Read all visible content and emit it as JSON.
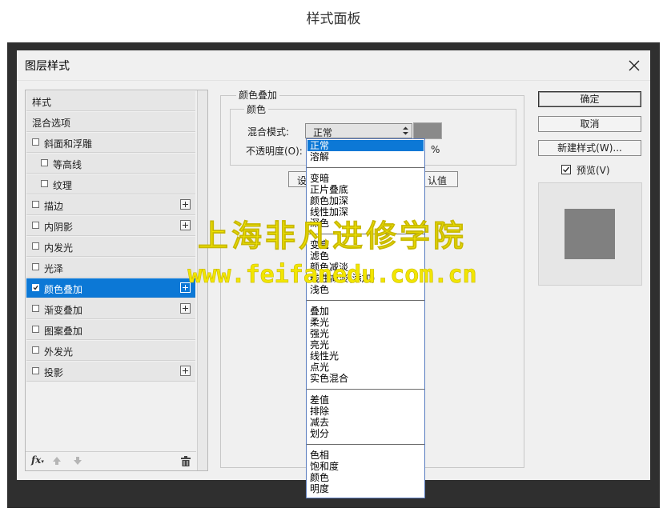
{
  "page_title": "样式面板",
  "dialog": {
    "title": "图层样式",
    "close_icon": "close-icon"
  },
  "style_list": {
    "items": [
      {
        "label": "样式",
        "checkbox": false,
        "plus": false,
        "indent": false,
        "selected": false,
        "checked": false
      },
      {
        "label": "混合选项",
        "checkbox": false,
        "plus": false,
        "indent": false,
        "selected": false,
        "checked": false
      },
      {
        "label": "斜面和浮雕",
        "checkbox": true,
        "plus": false,
        "indent": false,
        "selected": false,
        "checked": false
      },
      {
        "label": "等高线",
        "checkbox": true,
        "plus": false,
        "indent": true,
        "selected": false,
        "checked": false
      },
      {
        "label": "纹理",
        "checkbox": true,
        "plus": false,
        "indent": true,
        "selected": false,
        "checked": false
      },
      {
        "label": "描边",
        "checkbox": true,
        "plus": true,
        "indent": false,
        "selected": false,
        "checked": false
      },
      {
        "label": "内阴影",
        "checkbox": true,
        "plus": true,
        "indent": false,
        "selected": false,
        "checked": false
      },
      {
        "label": "内发光",
        "checkbox": true,
        "plus": false,
        "indent": false,
        "selected": false,
        "checked": false
      },
      {
        "label": "光泽",
        "checkbox": true,
        "plus": false,
        "indent": false,
        "selected": false,
        "checked": false
      },
      {
        "label": "颜色叠加",
        "checkbox": true,
        "plus": true,
        "indent": false,
        "selected": true,
        "checked": true
      },
      {
        "label": "渐变叠加",
        "checkbox": true,
        "plus": true,
        "indent": false,
        "selected": false,
        "checked": false
      },
      {
        "label": "图案叠加",
        "checkbox": true,
        "plus": false,
        "indent": false,
        "selected": false,
        "checked": false
      },
      {
        "label": "外发光",
        "checkbox": true,
        "plus": false,
        "indent": false,
        "selected": false,
        "checked": false
      },
      {
        "label": "投影",
        "checkbox": true,
        "plus": true,
        "indent": false,
        "selected": false,
        "checked": false
      }
    ],
    "footer": {
      "fx_label": "fx",
      "icons": [
        "fx-icon",
        "arrow-up-icon",
        "arrow-down-icon",
        "trash-icon"
      ]
    }
  },
  "color_overlay": {
    "group_title": "颜色叠加",
    "subgroup_title": "颜色",
    "blend_mode_label": "混合模式:",
    "blend_mode_value": "正常",
    "opacity_label": "不透明度(O):",
    "opacity_unit": "%",
    "swatch_color": "#8a8a8a",
    "partial_button_left": "设",
    "partial_button_right": "认值"
  },
  "blend_dropdown": {
    "selected": "正常",
    "groups": [
      [
        "正常",
        "溶解"
      ],
      [
        "变暗",
        "正片叠底",
        "颜色加深",
        "线性加深",
        "深色"
      ],
      [
        "变亮",
        "滤色",
        "颜色减淡",
        "线性减淡(添加)",
        "浅色"
      ],
      [
        "叠加",
        "柔光",
        "强光",
        "亮光",
        "线性光",
        "点光",
        "实色混合"
      ],
      [
        "差值",
        "排除",
        "减去",
        "划分"
      ],
      [
        "色相",
        "饱和度",
        "颜色",
        "明度"
      ]
    ]
  },
  "buttons": {
    "ok": "确定",
    "cancel": "取消",
    "new_style": "新建样式(W)..."
  },
  "preview": {
    "label": "预览(V)",
    "checked": true,
    "swatch_color": "#808080"
  },
  "watermark": {
    "line1": "上海非凡进修学院",
    "line2": "www.feifanedu.com.cn",
    "color": "#f2e600"
  },
  "colors": {
    "accent": "#0c78d6",
    "frame": "#2f2f2f",
    "dialog_bg": "#f0f0f0"
  }
}
